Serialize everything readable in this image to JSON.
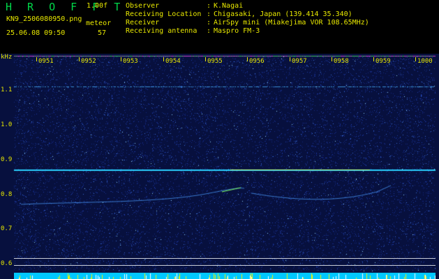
{
  "header": {
    "app_title": "H R O F F T",
    "version": "1.00f",
    "file_name": "KN9_2506080950.png",
    "meteor_label": "meteor",
    "date_time": "25.06.08 09:50",
    "meteor_count": "57"
  },
  "info": [
    {
      "key": "Observer",
      "value": "K.Nagai"
    },
    {
      "key": "Receiving Location",
      "value": "Chigasaki, Japan (139.414 35.340)"
    },
    {
      "key": "Receiver",
      "value": "AirSpy mini (Miakejima VOR 108.65MHz)"
    },
    {
      "key": "Receiving antenna",
      "value": "Maspro FM-3"
    }
  ],
  "spectrogram": {
    "freq_unit": "kHz",
    "time_labels": [
      "0951",
      "0952",
      "0953",
      "0954",
      "0955",
      "0956",
      "0957",
      "0958",
      "0959",
      "1000"
    ],
    "freq_labels": [
      "1.1",
      "1.0",
      "0.9",
      "0.8",
      "0.7",
      "0.6"
    ],
    "background_color": "#07103e",
    "carrier_color": "#2ad0ff",
    "meteor_echo_color": "#7dff5a",
    "noise_strip_color": "#00c8ff"
  }
}
